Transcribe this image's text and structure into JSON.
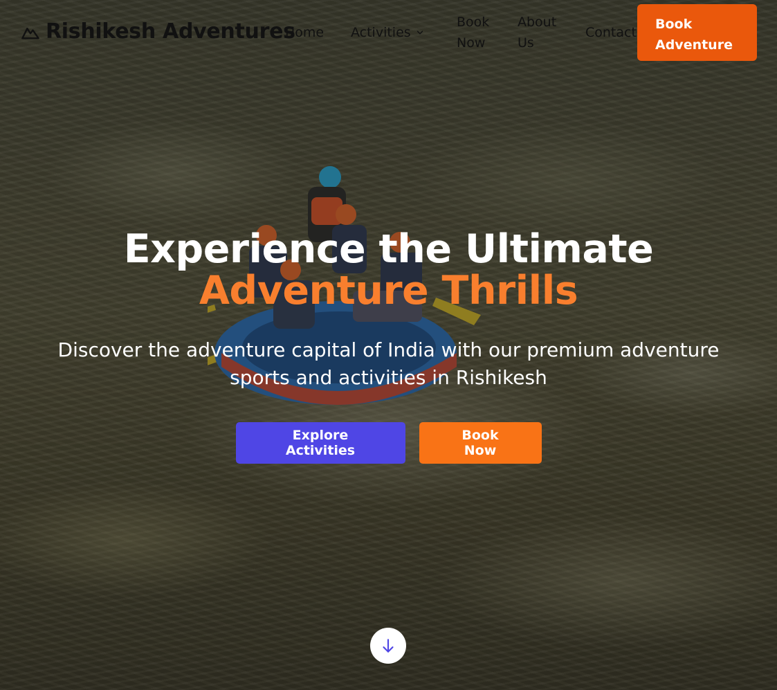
{
  "brand": {
    "name": "Rishikesh Adventures",
    "logo_icon": "mountain-icon"
  },
  "nav": {
    "home": "Home",
    "activities": "Activities",
    "book_now": "Book Now",
    "about_us": "About Us",
    "contact": "Contact",
    "cta": "Book Adventure"
  },
  "hero": {
    "title_line1": "Experience the Ultimate",
    "title_line2": "Adventure Thrills",
    "subtitle": "Discover the adventure capital of India with our premium adventure sports and activities in Rishikesh",
    "primary_button": "Explore Activities",
    "secondary_button": "Book Now",
    "scroll_icon": "arrow-down-icon"
  },
  "colors": {
    "accent_orange": "#f97316",
    "cta_orange": "#ea580c",
    "primary_indigo": "#4f46e5",
    "title_accent": "#f97f2e",
    "text_white": "#ffffff"
  }
}
